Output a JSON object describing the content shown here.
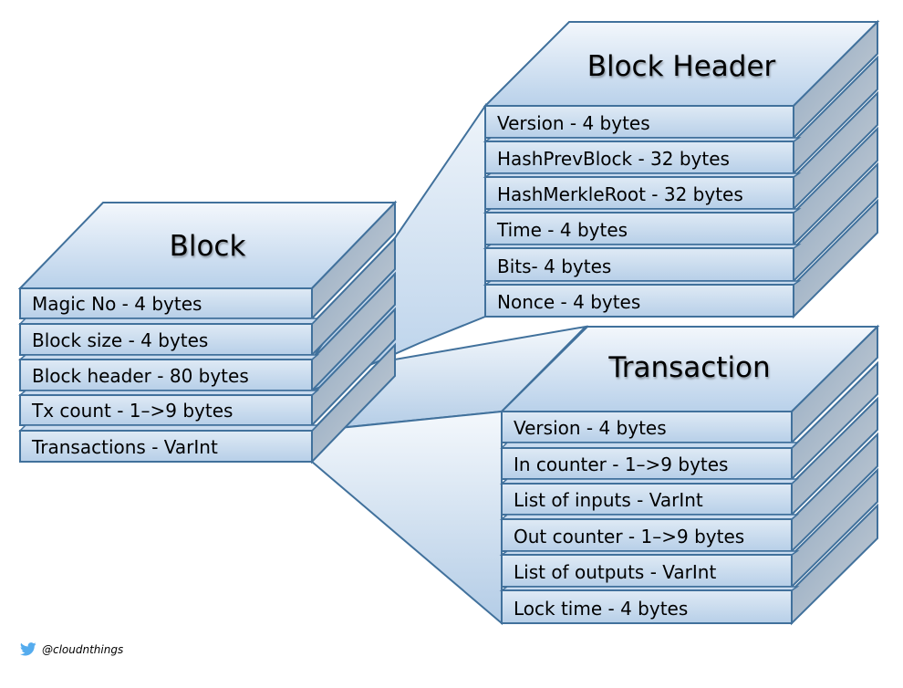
{
  "colors": {
    "stroke": "#41719c",
    "face_light": "#dfeaf5",
    "face_dark": "#b7cfe8",
    "side_light": "#c9cfd6",
    "side_dark": "#8ea7c0",
    "funnel_light": "#f2f6fb",
    "funnel_dark": "#b9d1ea",
    "twitter": "#55acee"
  },
  "block": {
    "title": "Block",
    "rows": [
      {
        "label": "Magic No - 4 bytes"
      },
      {
        "label": "Block size - 4 bytes"
      },
      {
        "label": "Block header - 80 bytes"
      },
      {
        "label": "Tx count - 1–>9 bytes"
      },
      {
        "label": "Transactions - VarInt"
      }
    ]
  },
  "block_header": {
    "title": "Block Header",
    "rows": [
      {
        "label": "Version - 4 bytes"
      },
      {
        "label": "HashPrevBlock - 32 bytes"
      },
      {
        "label": "HashMerkleRoot - 32 bytes"
      },
      {
        "label": "Time - 4 bytes"
      },
      {
        "label": "Bits- 4 bytes"
      },
      {
        "label": "Nonce - 4 bytes"
      }
    ]
  },
  "transaction": {
    "title": "Transaction",
    "rows": [
      {
        "label": "Version - 4 bytes"
      },
      {
        "label": "In counter - 1–>9 bytes"
      },
      {
        "label": "List of inputs - VarInt"
      },
      {
        "label": "Out counter - 1–>9 bytes"
      },
      {
        "label": "List of outputs - VarInt"
      },
      {
        "label": "Lock time - 4 bytes"
      }
    ]
  },
  "credit": {
    "icon": "twitter-bird-icon",
    "handle": "@cloudnthings"
  }
}
